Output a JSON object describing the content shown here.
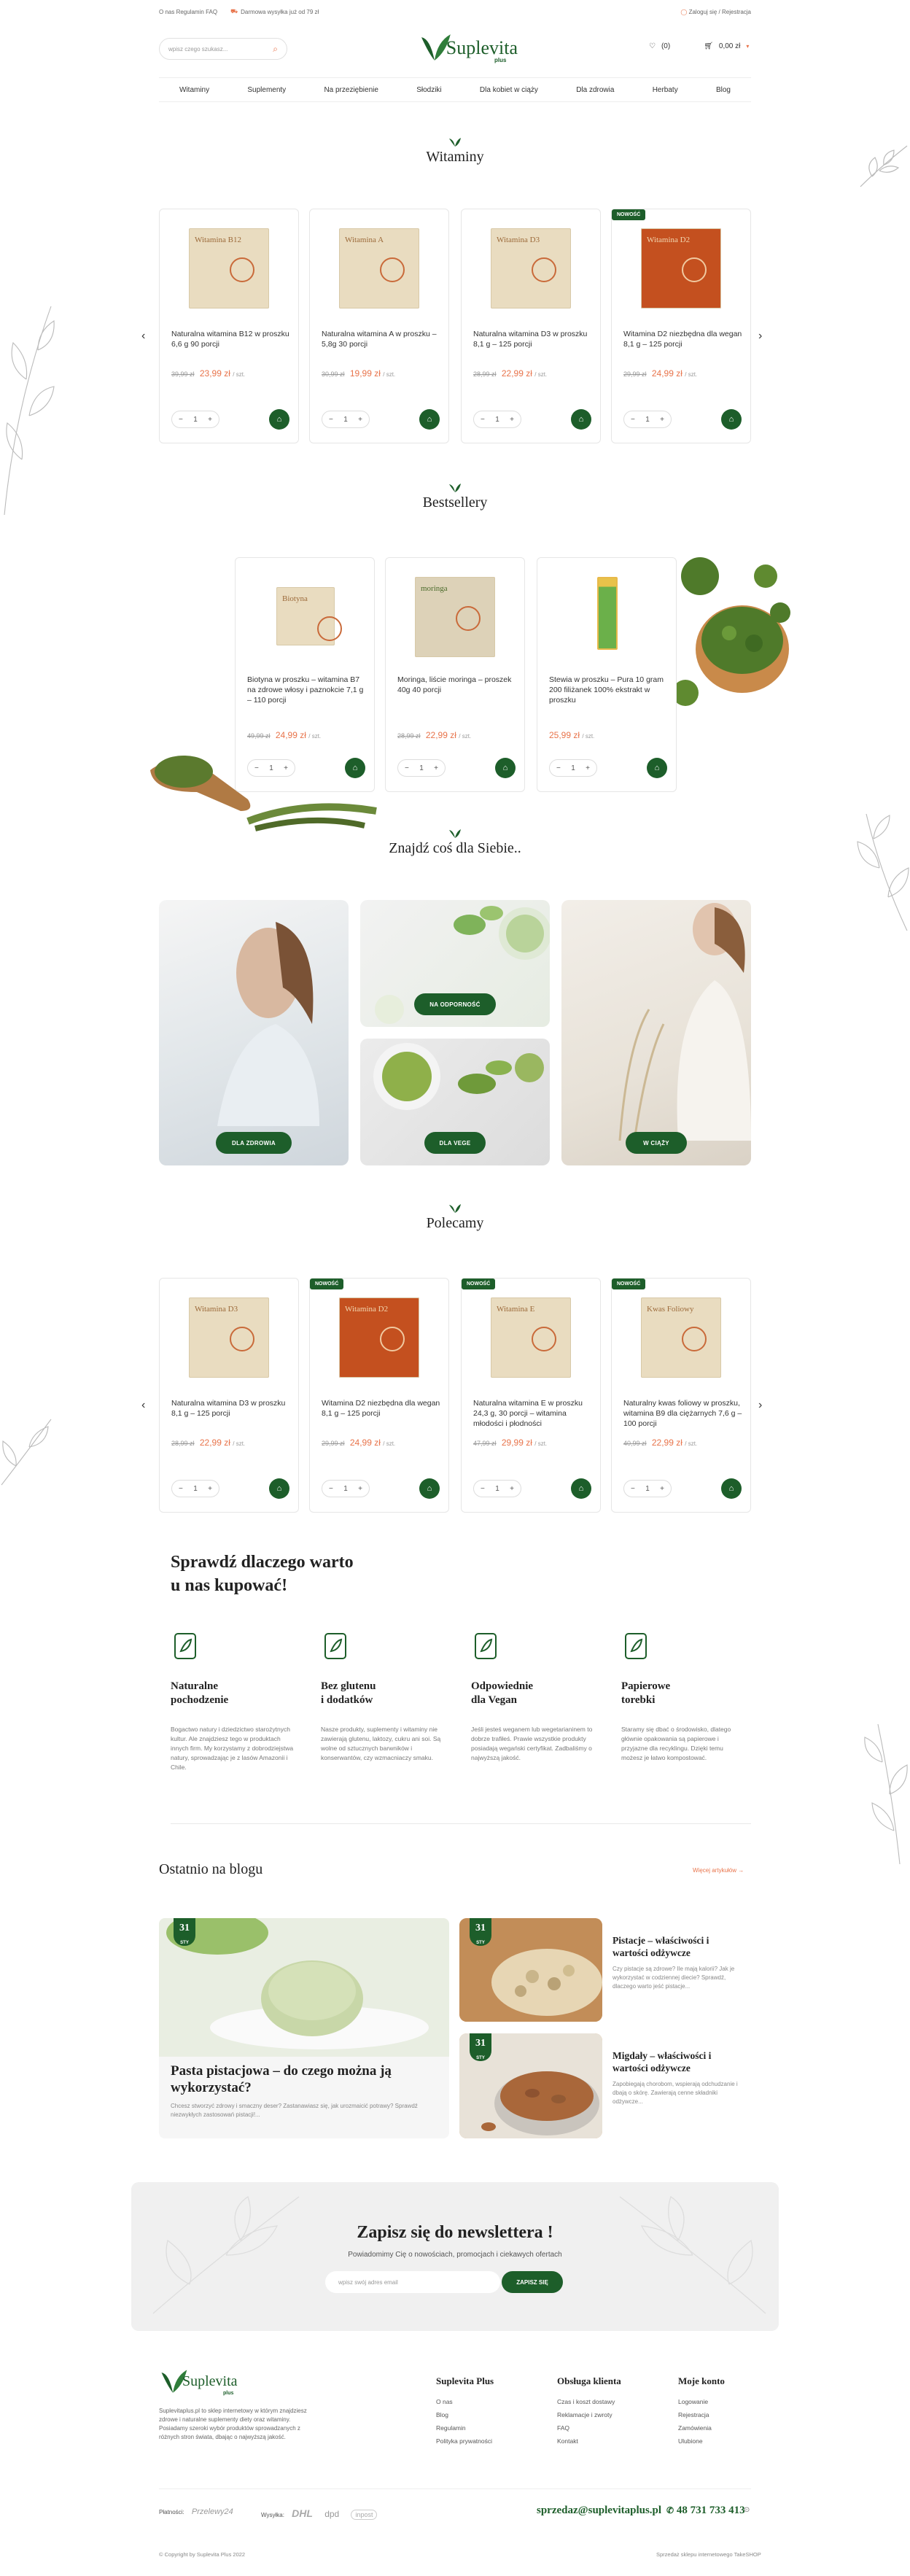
{
  "topbar": {
    "links": [
      "O nas",
      "Regulamin",
      "FAQ"
    ],
    "shipping": "Darmowa wysyłka już od 79 zł",
    "login": "Zaloguj się",
    "separator": "/",
    "register": "Rejestracja"
  },
  "header": {
    "search_placeholder": "wpisz czego szukasz...",
    "logo_name": "Suplevita",
    "logo_plus": "plus",
    "wishlist_count": "(0)",
    "cart_value": "0,00 zł"
  },
  "nav": [
    "Witaminy",
    "Suplementy",
    "Na przeziębienie",
    "Słodziki",
    "Dla kobiet w ciąży",
    "Dla zdrowia",
    "Herbaty",
    "Blog"
  ],
  "vitamins": {
    "title": "Witaminy",
    "products": [
      {
        "img": "Witamina B12",
        "name": "Naturalna witamina B12 w proszku 6,6 g 90 porcji",
        "old": "39,99 zł",
        "price": "23,99 zł",
        "per": "/ szt.",
        "badge": ""
      },
      {
        "img": "Witamina A",
        "name": "Naturalna witamina A w proszku – 5,8g 30 porcji",
        "old": "30,99 zł",
        "price": "19,99 zł",
        "per": "/ szt.",
        "badge": ""
      },
      {
        "img": "Witamina D3",
        "name": "Naturalna witamina D3 w proszku 8,1 g – 125 porcji",
        "old": "28,99 zł",
        "price": "22,99 zł",
        "per": "/ szt.",
        "badge": ""
      },
      {
        "img": "Witamina D2",
        "name": "Witamina D2 niezbędna dla wegan 8,1 g – 125 porcji",
        "old": "29,99 zł",
        "price": "24,99 zł",
        "per": "/ szt.",
        "badge": "NOWOŚĆ"
      }
    ]
  },
  "bestsellers": {
    "title": "Bestsellery",
    "products": [
      {
        "img": "Biotyna",
        "name": "Biotyna w proszku – witamina B7 na zdrowe włosy i paznokcie 7,1 g – 110 porcji",
        "old": "49,99 zł",
        "price": "24,99 zł",
        "per": "/ szt."
      },
      {
        "img": "moringa",
        "name": "Moringa, liście moringa – proszek 40g 40 porcji",
        "old": "28,99 zł",
        "price": "22,99 zł",
        "per": "/ szt."
      },
      {
        "img": "Stewia",
        "name": "Stewia w proszku – Pura 10 gram 200 filiżanek 100% ekstrakt w proszku",
        "old": "",
        "price": "25,99 zł",
        "per": "/ szt."
      }
    ]
  },
  "categories": {
    "title": "Znajdź coś dla Siebie..",
    "tiles": [
      "DLA ZDROWIA",
      "NA ODPORNOŚĆ",
      "DLA VEGE",
      "W CIĄŻY"
    ]
  },
  "recommended": {
    "title": "Polecamy",
    "products": [
      {
        "img": "Witamina D3",
        "name": "Naturalna witamina D3 w proszku 8,1 g – 125 porcji",
        "old": "28,99 zł",
        "price": "22,99 zł",
        "per": "/ szt.",
        "badge": ""
      },
      {
        "img": "Witamina D2",
        "name": "Witamina D2 niezbędna dla wegan 8,1 g – 125 porcji",
        "old": "29,99 zł",
        "price": "24,99 zł",
        "per": "/ szt.",
        "badge": "NOWOŚĆ"
      },
      {
        "img": "Witamina E",
        "name": "Naturalna witamina E w proszku 24,3 g, 30 porcji – witamina młodości i płodności",
        "old": "47,99 zł",
        "price": "29,99 zł",
        "per": "/ szt.",
        "badge": "NOWOŚĆ"
      },
      {
        "img": "Kwas Foliowy",
        "name": "Naturalny kwas foliowy w proszku, witamina B9 dla ciężarnych 7,6 g – 100 porcji",
        "old": "40,99 zł",
        "price": "22,99 zł",
        "per": "/ szt.",
        "badge": "NOWOŚĆ"
      }
    ]
  },
  "why": {
    "title_line1": "Sprawdź dlaczego warto",
    "title_line2": "u nas kupować!",
    "features": [
      {
        "icon": "natural-origin-icon",
        "line1": "Naturalne",
        "line2": "pochodzenie",
        "text": "Bogactwo natury i dziedzictwo starożytnych kultur. Ale znajdziesz tego w produktach innych firm. My korzystamy z dobrodziejstwa natury, sprowadzając je z lasów Amazonii i Chile."
      },
      {
        "icon": "gluten-free-icon",
        "line1": "Bez glutenu",
        "line2": "i dodatków",
        "text": "Nasze produkty, suplementy i witaminy nie zawierają glutenu, laktozy, cukru ani soi. Są wolne od sztucznych barwników i konserwantów, czy wzmacniaczy smaku."
      },
      {
        "icon": "vegan-icon",
        "line1": "Odpowiednie",
        "line2": "dla Vegan",
        "text": "Jeśli jesteś weganem lub wegetarianinem to dobrze trafiłeś. Prawie wszystkie produkty posiadają wegański certyfikat. Zadbaliśmy o najwyższą jakość."
      },
      {
        "icon": "paper-bag-icon",
        "line1": "Papierowe",
        "line2": "torebki",
        "text": "Staramy się dbać o środowisko, dlatego głównie opakowania są papierowe i przyjazne dla recyklingu. Dzięki temu możesz je łatwo kompostować."
      }
    ]
  },
  "blog": {
    "title": "Ostatnio na blogu",
    "more": "Więcej artykułów →",
    "main": {
      "day": "31",
      "month": "STY",
      "title": "Pasta pistacjowa – do czego można ją wykorzystać?",
      "excerpt": "Chcesz stworzyć zdrowy i smaczny deser? Zastanawiasz się, jak urozmaicić potrawy? Sprawdź niezwykłych zastosowań pistacji!..."
    },
    "side": [
      {
        "day": "31",
        "month": "STY",
        "title": "Pistacje – właściwości i wartości odżywcze",
        "excerpt": "Czy pistacje są zdrowe? Ile mają kalorii? Jak je wykorzystać w codziennej diecie? Sprawdź, dlaczego warto jeść pistacje..."
      },
      {
        "day": "31",
        "month": "STY",
        "title": "Migdały – właściwości i wartości odżywcze",
        "excerpt": "Zapobiegają chorobom, wspierają odchudzanie i dbają o skórę. Zawierają cenne składniki odżywcze..."
      }
    ]
  },
  "newsletter": {
    "title": "Zapisz się do newslettera !",
    "subtitle": "Powiadomimy Cię o nowościach, promocjach i ciekawych ofertach",
    "placeholder": "wpisz swój adres email",
    "button": "ZAPISZ SIĘ"
  },
  "footer": {
    "description": "Suplevitaplus.pl to sklep internetowy w którym znajdziesz zdrowe i naturalne suplementy diety oraz witaminy. Posiadamy szeroki wybór produktów sprowadzanych z różnych stron świata, dbając o najwyższą jakość.",
    "columns": [
      {
        "title": "Suplevita Plus",
        "links": [
          "O nas",
          "Blog",
          "Regulamin",
          "Polityka prywatności"
        ]
      },
      {
        "title": "Obsługa klienta",
        "links": [
          "Czas i koszt dostawy",
          "Reklamacje i zwroty",
          "FAQ",
          "Kontakt"
        ]
      },
      {
        "title": "Moje konto",
        "links": [
          "Logowanie",
          "Rejestracja",
          "Zamówienia",
          "Ulubione"
        ]
      }
    ],
    "payments_label": "Płatności:",
    "payments": [
      "Przelewy24"
    ],
    "shipping_label": "Wysyłka:",
    "carriers": [
      "DHL",
      "dpd",
      "inpost"
    ],
    "email": "sprzedaz@suplevitaplus.pl",
    "phone": "48 731 733 413",
    "copyright": "© Copyright by Suplevita Plus 2022",
    "credit": "Sprzedaż sklepu internetowego TakeSHOP"
  }
}
